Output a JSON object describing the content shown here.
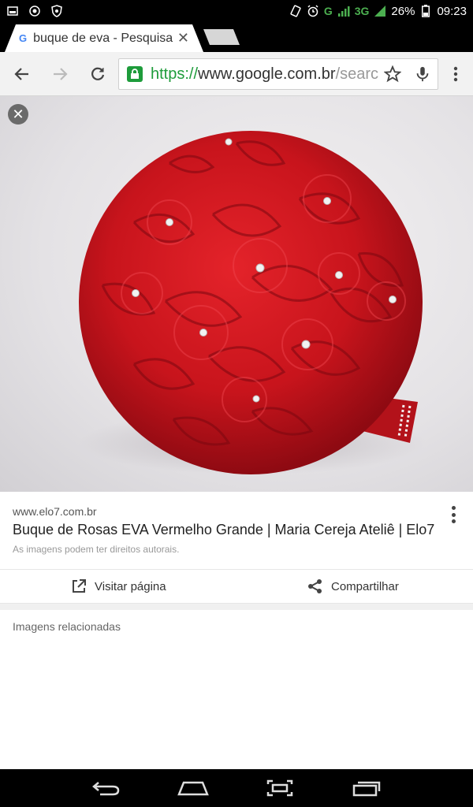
{
  "status_bar": {
    "network": "G",
    "network_type": "3G",
    "battery": "26%",
    "time": "09:23"
  },
  "tab": {
    "favicon": "G",
    "title": "buque de eva - Pesquisa Google"
  },
  "toolbar": {
    "url_scheme": "https://",
    "url_host": "www.google.com.br",
    "url_path": "/search"
  },
  "result": {
    "site": "www.elo7.com.br",
    "title": "Buque de Rosas EVA Vermelho Grande | Maria Cereja Ateliê | Elo7",
    "rights_note": "As imagens podem ter direitos autorais."
  },
  "actions": {
    "visit": "Visitar página",
    "share": "Compartilhar"
  },
  "related": {
    "title": "Imagens relacionadas"
  },
  "colors": {
    "rose": "#c8141c",
    "secure": "#1e9c3b"
  }
}
